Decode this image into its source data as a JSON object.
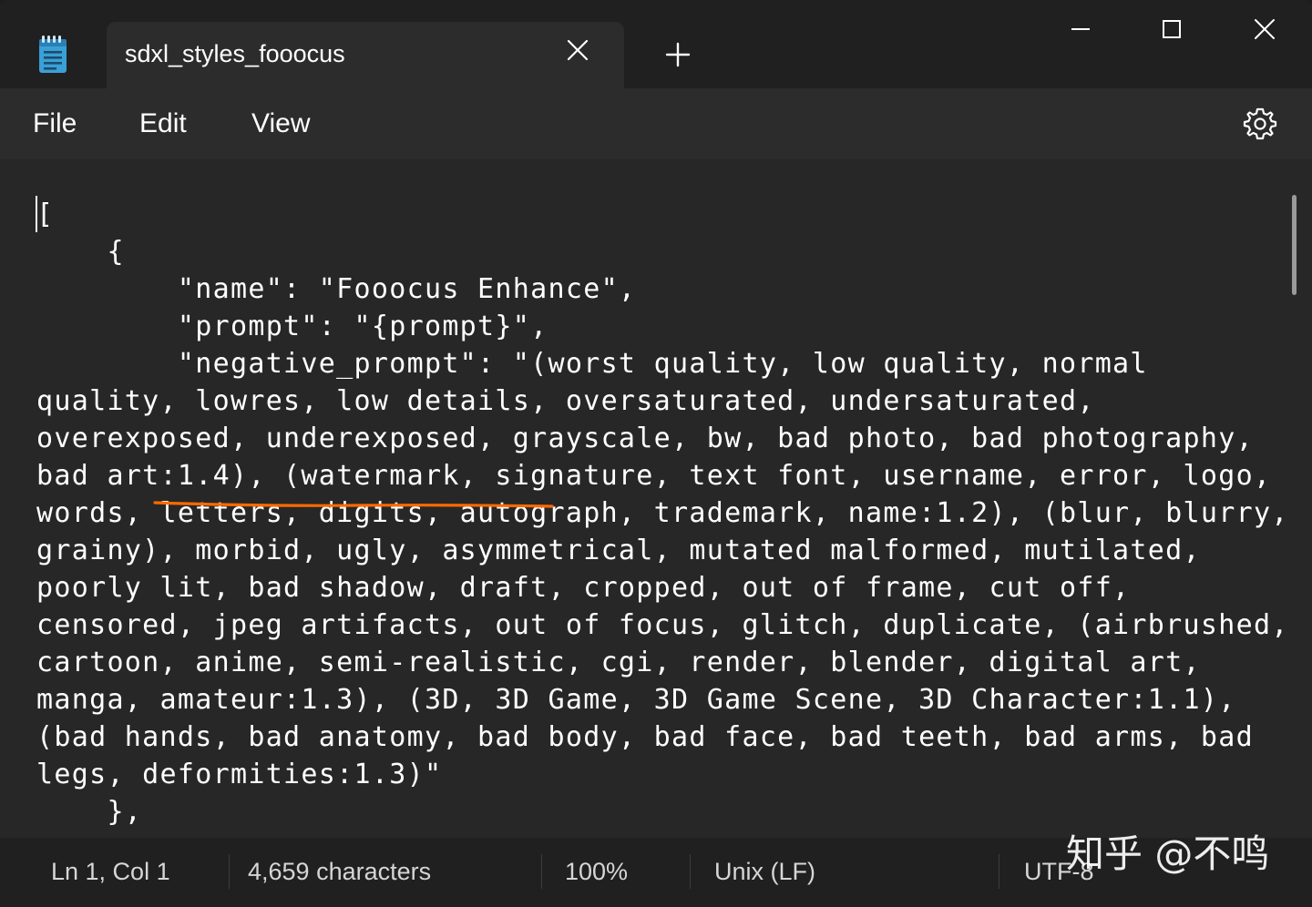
{
  "tab": {
    "title": "sdxl_styles_fooocus",
    "close_label": "Close tab",
    "new_tab_label": "New tab"
  },
  "window_controls": {
    "minimize": "Minimize",
    "maximize": "Maximize",
    "close": "Close"
  },
  "menu": {
    "file": "File",
    "edit": "Edit",
    "view": "View",
    "settings_icon": "gear-icon"
  },
  "editor": {
    "lines": [
      "[",
      "    {",
      "        \"name\": \"Fooocus Enhance\",",
      "        \"prompt\": \"{prompt}\",",
      "        \"negative_prompt\": \"(worst quality, low quality, normal",
      "quality, lowres, low details, oversaturated, undersaturated,",
      "overexposed, underexposed, grayscale, bw, bad photo, bad photography,",
      "bad art:1.4), (watermark, signature, text font, username, error, logo,",
      "words, letters, digits, autograph, trademark, name:1.2), (blur, blurry,",
      "grainy), morbid, ugly, asymmetrical, mutated malformed, mutilated,",
      "poorly lit, bad shadow, draft, cropped, out of frame, cut off,",
      "censored, jpeg artifacts, out of focus, glitch, duplicate, (airbrushed,",
      "cartoon, anime, semi-realistic, cgi, render, blender, digital art,",
      "manga, amateur:1.3), (3D, 3D Game, 3D Game Scene, 3D Character:1.1),",
      "(bad hands, bad anatomy, bad body, bad face, bad teeth, bad arms, bad",
      "legs, deformities:1.3)\"",
      "    },"
    ],
    "highlight_color": "#ff6a00"
  },
  "status": {
    "position": "Ln 1, Col 1",
    "characters": "4,659 characters",
    "zoom": "100%",
    "line_ending": "Unix (LF)",
    "encoding": "UTF-8"
  },
  "watermark": "知乎 @不鸣",
  "colors": {
    "titlebar": "#202020",
    "menubar": "#2c2c2c",
    "editor": "#272727",
    "accent": "#ff6a00"
  }
}
